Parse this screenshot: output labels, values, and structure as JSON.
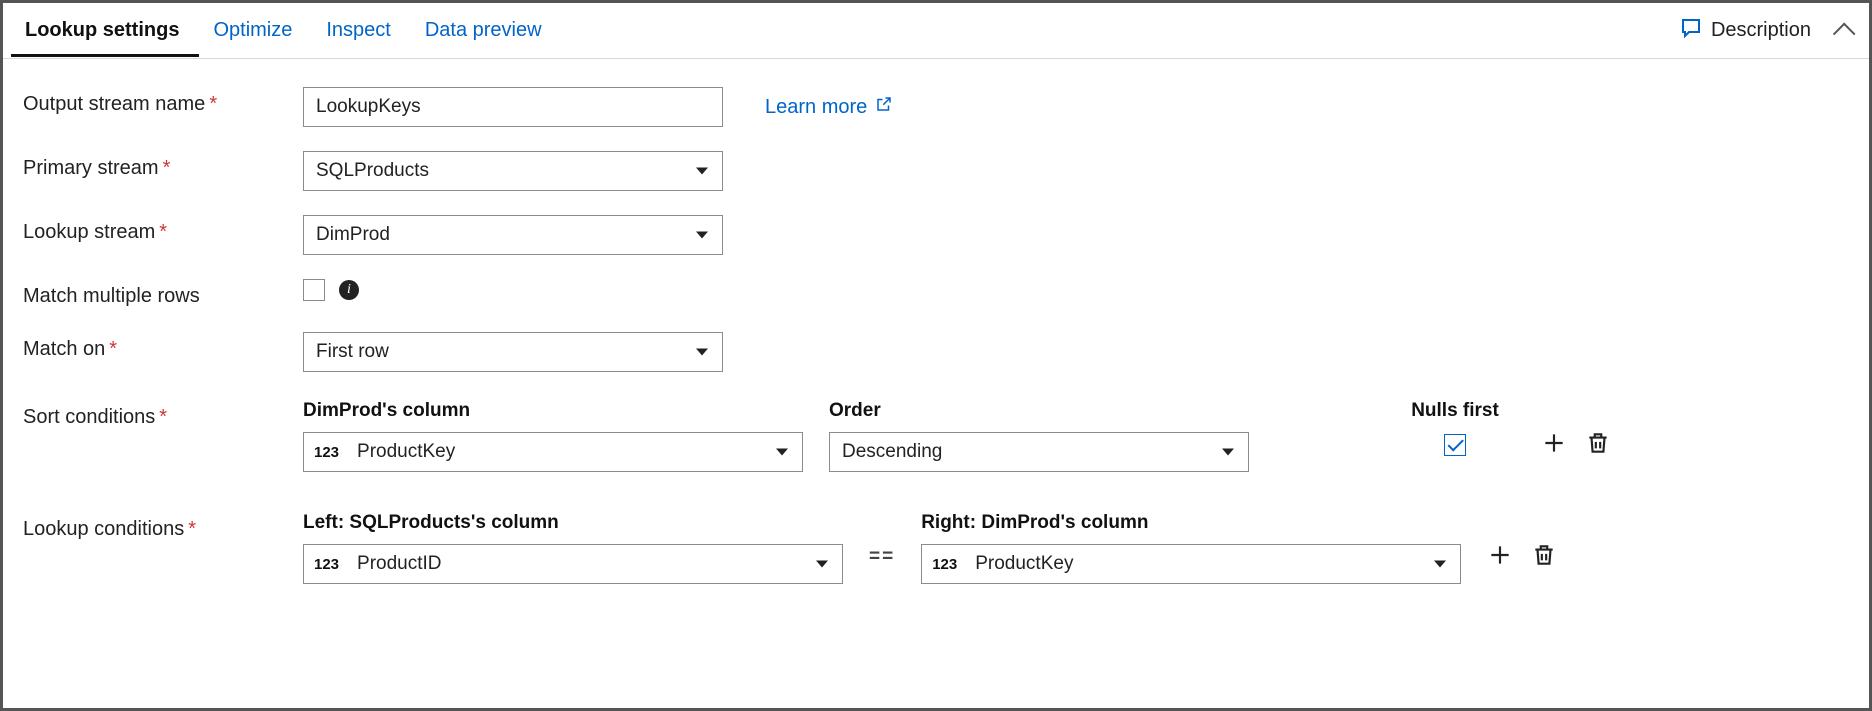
{
  "tabs": {
    "lookup_settings": "Lookup settings",
    "optimize": "Optimize",
    "inspect": "Inspect",
    "data_preview": "Data preview"
  },
  "description_btn": "Description",
  "labels": {
    "output_stream_name": "Output stream name",
    "primary_stream": "Primary stream",
    "lookup_stream": "Lookup stream",
    "match_multiple_rows": "Match multiple rows",
    "match_on": "Match on",
    "sort_conditions": "Sort conditions",
    "lookup_conditions": "Lookup conditions"
  },
  "values": {
    "output_stream_name": "LookupKeys",
    "primary_stream": "SQLProducts",
    "lookup_stream": "DimProd",
    "match_multiple_rows": false,
    "match_on": "First row"
  },
  "learn_more": "Learn more",
  "sort": {
    "column_header": "DimProd's column",
    "order_header": "Order",
    "nulls_header": "Nulls first",
    "type_chip": "123",
    "column": "ProductKey",
    "order": "Descending",
    "nulls_first": true
  },
  "lookup": {
    "left_header": "Left: SQLProducts's column",
    "right_header": "Right: DimProd's column",
    "type_chip": "123",
    "left_column": "ProductID",
    "right_column": "ProductKey",
    "operator": "=="
  }
}
